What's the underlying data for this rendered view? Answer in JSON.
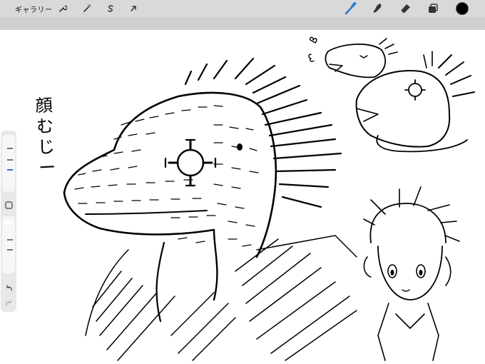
{
  "toolbar": {
    "gallery_label": "ギャラリー",
    "left_tools": [
      "wrench-icon",
      "magic-wand-icon",
      "selection-s-icon",
      "transform-arrow-icon"
    ],
    "right_tools": [
      "brush-icon",
      "smudge-icon",
      "eraser-icon",
      "layers-icon"
    ],
    "active_tool": "brush-icon",
    "accent_color": "#2a7bd4",
    "current_color": "#000000"
  },
  "canvas": {
    "handwritten_text": "顔むじー"
  },
  "sidebar": {
    "buttons": [
      "brush-size-slider",
      "modify-square-icon",
      "opacity-slider",
      "undo-icon",
      "redo-icon"
    ]
  }
}
